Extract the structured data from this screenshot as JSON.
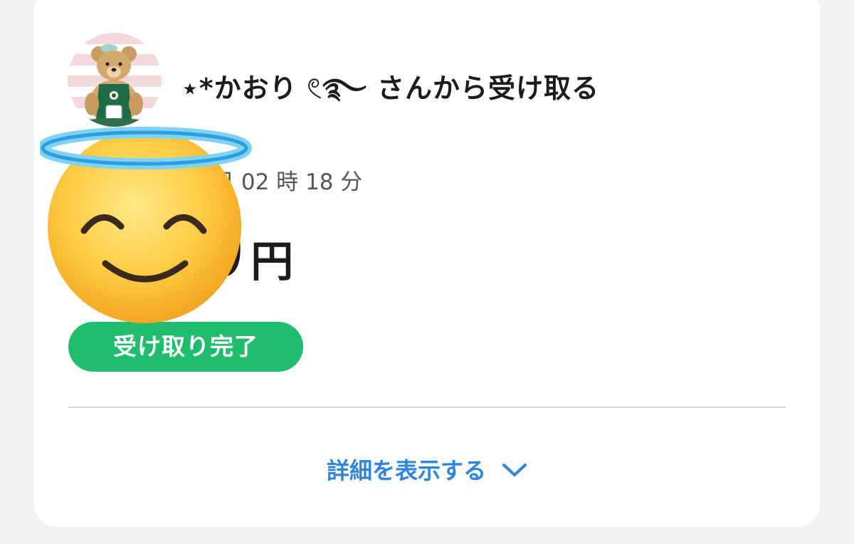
{
  "receive": {
    "title": "⋆*かおり 𓏲࿐ さんから受け取る",
    "datetime": "日 02 時 18 分",
    "amount": "0",
    "currency": "円",
    "status": "受け取り完了"
  },
  "details": {
    "label": "詳細を表示する",
    "icon": "chevron-down-icon"
  },
  "colors": {
    "status_green": "#1fbd6d",
    "link_blue": "#2f84e0"
  },
  "overlay": {
    "emoji": "smiling-face-with-halo"
  }
}
